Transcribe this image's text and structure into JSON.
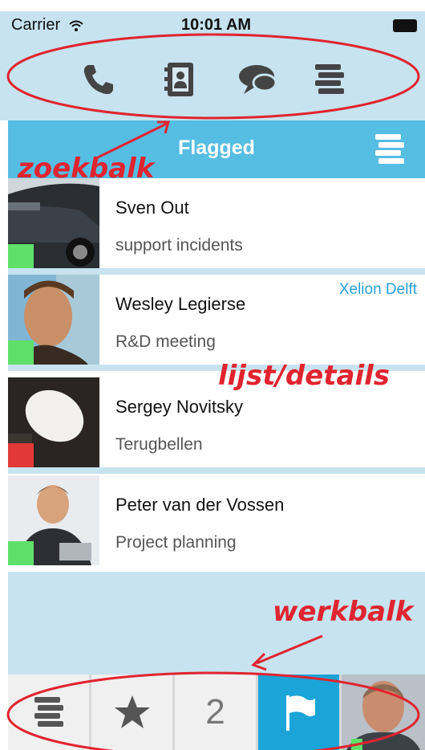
{
  "status_bar": {
    "carrier": "Carrier",
    "time": "10:01 AM"
  },
  "top_icons": [
    "phone-icon",
    "contacts-icon",
    "chat-icon",
    "list-icon"
  ],
  "header": {
    "title": "Flagged"
  },
  "contacts": [
    {
      "name": "Sven Out",
      "subject": "support incidents",
      "company": "",
      "status_color": "#5ee06a"
    },
    {
      "name": "Wesley Legierse",
      "subject": "R&D meeting",
      "company": "Xelion Delft",
      "status_color": "#5ee06a"
    },
    {
      "name": "Sergey Novitsky",
      "subject": "Terugbellen",
      "company": "",
      "status_color": "#e23838"
    },
    {
      "name": "Peter van der Vossen",
      "subject": "Project planning",
      "company": "",
      "status_color": "#5ee06a"
    }
  ],
  "tabs": {
    "count_label": "2"
  },
  "annotations": {
    "search_bar": "zoekbalk",
    "list_details": "lijst/details",
    "toolbar": "werkbalk"
  },
  "colors": {
    "accent": "#56bde3",
    "active_tab": "#1aa4d8",
    "background": "#c6e3ef",
    "annotation": "#e0242f"
  }
}
